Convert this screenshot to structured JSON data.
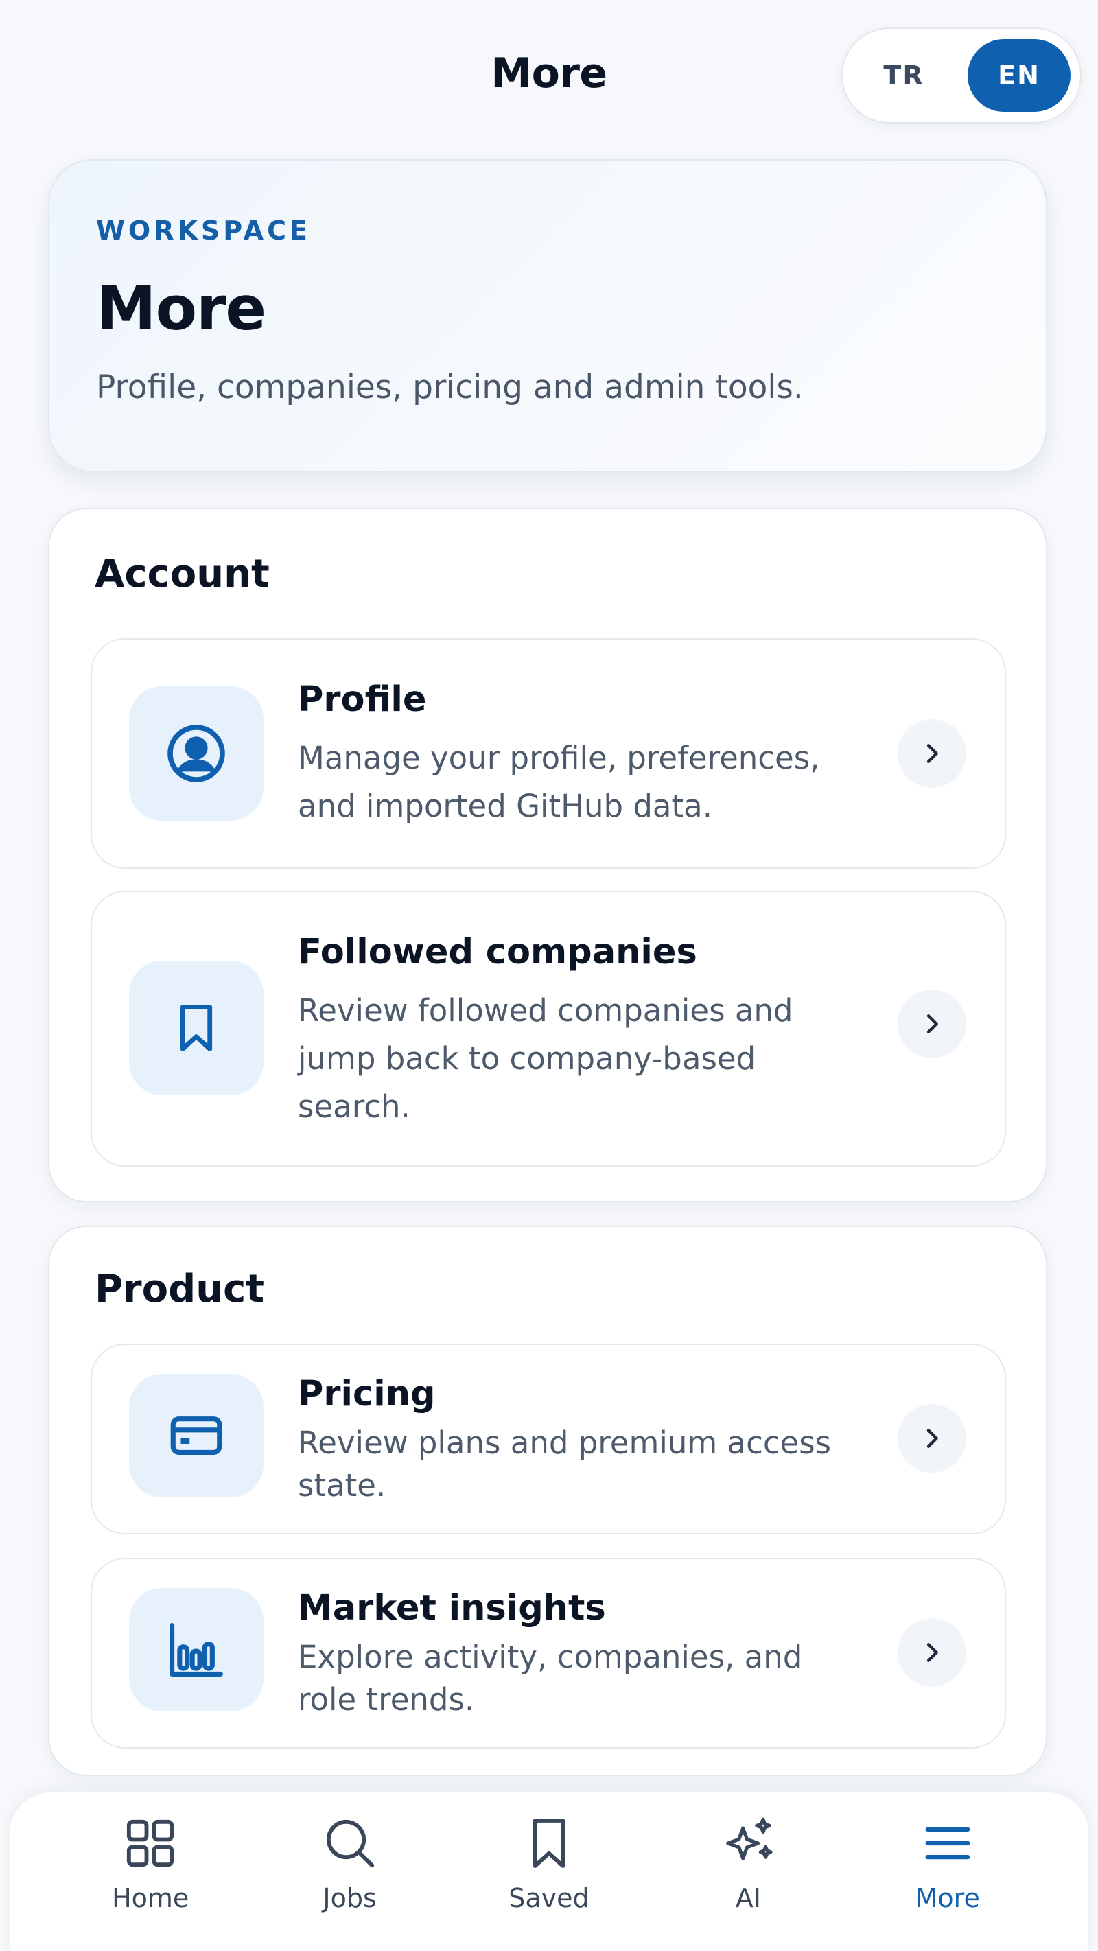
{
  "header": {
    "title": "More",
    "lang_options": [
      "TR",
      "EN"
    ],
    "active_lang": "EN"
  },
  "hero": {
    "eyebrow": "WORKSPACE",
    "title": "More",
    "subtitle": "Profile, companies, pricing and admin tools."
  },
  "sections": [
    {
      "title": "Account",
      "items": [
        {
          "title": "Profile",
          "desc_lines": [
            "Manage your profile, preferences,",
            "and imported GitHub data."
          ],
          "icon": "user-circle-icon"
        },
        {
          "title": "Followed companies",
          "desc_lines": [
            "Review followed companies and",
            "jump back to company-based",
            "search."
          ],
          "icon": "bookmark-icon"
        }
      ]
    },
    {
      "title": "Product",
      "items": [
        {
          "title": "Pricing",
          "desc_lines": [
            "Review plans and premium access",
            "state."
          ],
          "icon": "credit-card-icon"
        },
        {
          "title": "Market insights",
          "desc_lines": [
            "Explore activity, companies, and",
            "role trends."
          ],
          "icon": "bar-chart-icon"
        }
      ]
    }
  ],
  "bottom_nav": {
    "items": [
      {
        "label": "Home",
        "icon": "grid-icon"
      },
      {
        "label": "Jobs",
        "icon": "search-icon"
      },
      {
        "label": "Saved",
        "icon": "bookmark-icon"
      },
      {
        "label": "AI",
        "icon": "sparkles-icon"
      },
      {
        "label": "More",
        "icon": "menu-icon"
      }
    ],
    "active": "More"
  },
  "colors": {
    "accent": "#0f61b0",
    "icon_bg": "#e6f1fb",
    "page_bg": "#f6f8fb"
  }
}
